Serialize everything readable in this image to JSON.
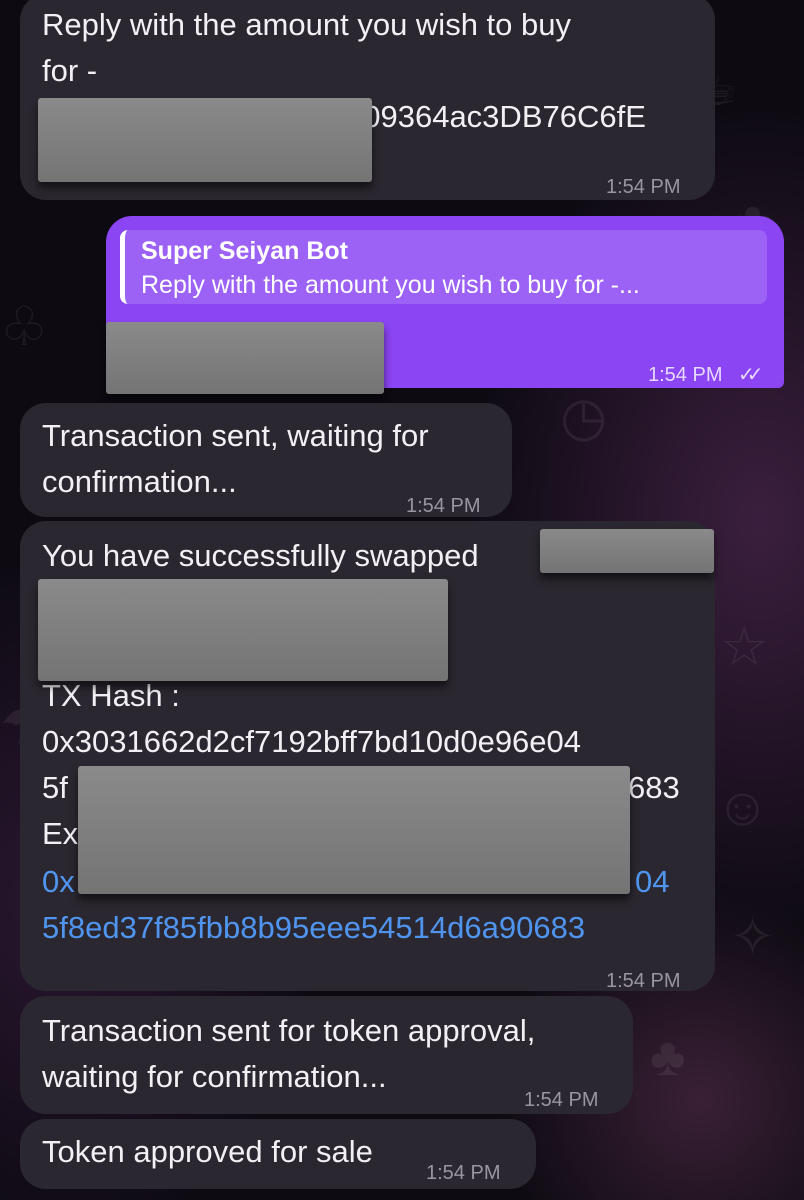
{
  "messages": [
    {
      "lines": [
        "Reply with the amount you wish to buy",
        "for -",
        "009364ac3DB76C6fE"
      ],
      "time": "1:54 PM"
    },
    {
      "reply_to_name": "Super Seiyan Bot",
      "reply_to_text": "Reply with the amount you wish to buy for -...",
      "time": "1:54 PM",
      "status_icon": "double-check-icon"
    },
    {
      "lines": [
        "Transaction sent, waiting for",
        "confirmation..."
      ],
      "time": "1:54 PM"
    },
    {
      "lines": [
        "You have successfully swapped",
        "TX Hash :",
        "0x3031662d2cf7192bff7bd10d0e96e04",
        "5f",
        "683",
        "Ex",
        "0x",
        "04",
        "5f8ed37f85fbb8b95eee54514d6a90683"
      ],
      "time": "1:54 PM",
      "link_color": "#4f95ef"
    },
    {
      "lines": [
        "Transaction sent for token approval,",
        "waiting for confirmation..."
      ],
      "time": "1:54 PM"
    },
    {
      "lines": [
        "Token approved for sale"
      ],
      "time": "1:54 PM"
    }
  ],
  "colors": {
    "incoming_bubble": "#2b2730",
    "outgoing_bubble": "#8b45f3",
    "link": "#4f95ef"
  }
}
